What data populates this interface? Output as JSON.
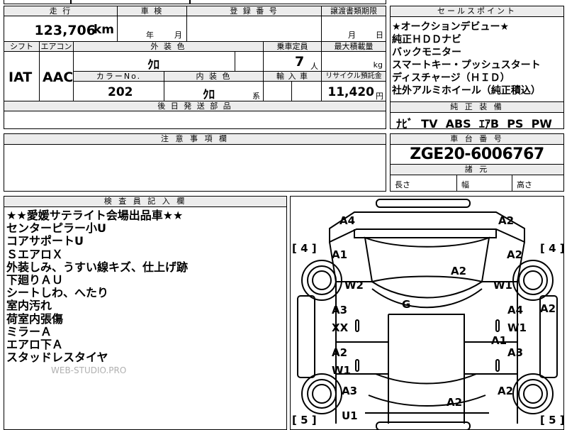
{
  "top_strip": {
    "partial_text": "▌▌▌▌▌"
  },
  "grade_sheet": {
    "headers": {
      "mileage": "走 行",
      "inspection": "車 検",
      "registration_no": "登 録 番 号",
      "transfer_deadline": "譲渡書類期限",
      "shift": "シフト",
      "aircon": "エアコン",
      "exterior_color": "外 装 色",
      "capacity": "乗車定員",
      "max_load": "最大積載量",
      "color_no": "カラーNo.",
      "interior_color": "内 装 色",
      "import_car": "輸 入 車",
      "recycle_fee": "リサイクル預託金",
      "later_parts": "後 日 発 送 部 品",
      "caution": "注 意 事 項 欄"
    },
    "mileage_value": "123,706",
    "mileage_unit": "km",
    "inspection_year_unit": "年",
    "inspection_month_unit": "月",
    "transfer_month_unit": "月",
    "transfer_day_unit": "日",
    "shift_value": "IAT",
    "aircon_value": "AAC",
    "exterior_color_value": "ｸﾛ",
    "capacity_value": "7",
    "capacity_unit": "人",
    "max_load_unit": "kg",
    "color_no_value": "202",
    "interior_color_value": "ｸﾛ",
    "interior_color_suffix": "系",
    "recycle_fee_value": "11,420",
    "recycle_fee_unit": "円"
  },
  "sales_points": {
    "header": "セールスポイント",
    "items": [
      "★オークションデビュー★",
      "純正ＨＤＤナビ",
      "バックモニター",
      "スマートキー・プッシュスタート",
      "ディスチャージ（ＨＩＤ）",
      "社外アルミホイール（純正積込）"
    ]
  },
  "equipment": {
    "header": "純 正 装 備",
    "items": [
      "ﾅﾋﾞ",
      "TV",
      "ABS",
      "ｴｱB",
      "PS",
      "PW"
    ]
  },
  "chassis": {
    "header": "車 台 番 号",
    "value": "ZGE20-6006767",
    "dims_header": "諸 元",
    "length_label": "長さ",
    "width_label": "幅",
    "height_label": "高さ"
  },
  "inspector": {
    "header": "検 査 員 記 入 欄",
    "notes": [
      "★★愛媛サテライト会場出品車★★",
      "センターピラー小U",
      "コアサポートU",
      "ＳエアロＸ",
      "外装しみ、うすい線キズ、仕上げ跡",
      "下廻りＡＵ",
      "シートしわ、へたり",
      "室内汚れ",
      "荷室内張傷",
      "ミラーＡ",
      "エアロ下Ａ",
      "スタッドレスタイヤ"
    ],
    "watermark": "WEB-STUDIO.PRO"
  },
  "car_map": {
    "marks": [
      "A4",
      "A2",
      "A1",
      "A2",
      "A2",
      "W2",
      "W1",
      "G",
      "A3",
      "A4",
      "A2",
      "XX",
      "W1",
      "A1",
      "A2",
      "A3",
      "W1",
      "A3",
      "A2",
      "A2",
      "U1"
    ],
    "brackets": [
      "[ 4 ]",
      "[ 4 ]",
      "[ 5 ]",
      "[ 5 ]"
    ]
  }
}
